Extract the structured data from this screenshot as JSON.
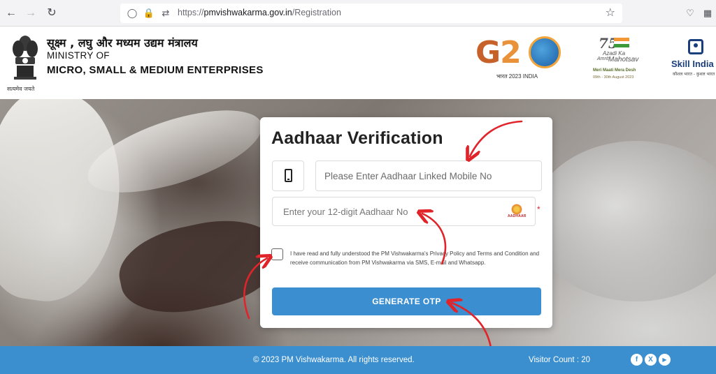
{
  "browser": {
    "url_prefix": "https://",
    "url_host": "pmvishwakarma.gov.in",
    "url_path": "/Registration",
    "icons": [
      "back-icon",
      "forward-icon",
      "reload-icon",
      "shield-icon",
      "lock-icon",
      "permissions-icon",
      "bookmark-star-icon",
      "pocket-icon",
      "extensions-icon"
    ]
  },
  "header": {
    "ministry_hindi": "सूक्ष्म , लघु और मध्यम उद्यम मंत्रालय",
    "ministry_of": "MINISTRY OF",
    "ministry_name": "MICRO, SMALL & MEDIUM ENTERPRISES",
    "emblem_motto": "सत्यमेव जयते",
    "g20": {
      "text_g": "G",
      "text_2": "2",
      "sub": "भारत 2023 INDIA"
    },
    "azadi": {
      "number": "75",
      "line1": "Azadi Ka",
      "line2": "Amrit",
      "line3": "Mahotsav",
      "line4": "Meri Maati Mera Desh",
      "line5": "09th - 30th August 2023"
    },
    "skill": {
      "text": "Skill India",
      "sub": "कौशल भारत - कुशल भारत"
    }
  },
  "form": {
    "title": "Aadhaar Verification",
    "mobile_placeholder": "Please Enter Aadhaar Linked Mobile No",
    "aadhaar_placeholder": "Enter your 12-digit Aadhaar No",
    "aadhaar_logo_text": "AADHAAR",
    "required_mark": "*",
    "consent": "I have read and fully understood the PM Vishwakarma's Privacy Policy and Terms and Condition and receive communication from PM Vishwakarma via SMS, E-mail and Whatsapp.",
    "button": "GENERATE OTP"
  },
  "footer": {
    "copyright": "© 2023 PM Vishwakarma. All rights reserved.",
    "visitor_count": "Visitor Count : 20",
    "social": [
      "f",
      "X",
      "▶"
    ]
  },
  "colors": {
    "primary_blue": "#3b8fd0",
    "annotation_red": "#e0242a",
    "required_red": "#e0242a"
  }
}
